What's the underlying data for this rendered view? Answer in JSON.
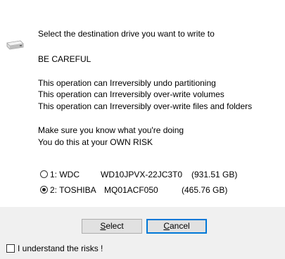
{
  "message": {
    "line1": "Select the destination drive you want to write to",
    "line2": "BE CAREFUL",
    "line3": "This operation can Irreversibly undo partitioning",
    "line4": "This operation can Irreversibly over-write volumes",
    "line5": "This operation can Irreversibly over-write files and folders",
    "line6": "Make sure you know what you're doing",
    "line7": "You do this at your OWN RISK"
  },
  "drives": [
    {
      "label": "1: WDC",
      "model": "WD10JPVX-22JC3T0",
      "size": "(931.51 GB)",
      "selected": false
    },
    {
      "label": "2: TOSHIBA",
      "model": "MQ01ACF050",
      "size": "(465.76 GB)",
      "selected": true
    }
  ],
  "buttons": {
    "select_first": "S",
    "select_rest": "elect",
    "cancel_first": "C",
    "cancel_rest": "ancel"
  },
  "checkbox": {
    "label": "I understand the risks !",
    "checked": false
  },
  "icon": "hard-drive-icon"
}
